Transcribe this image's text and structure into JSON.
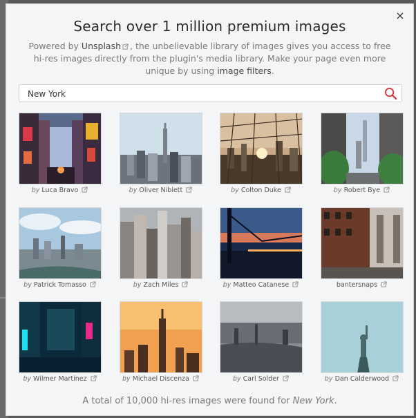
{
  "modal": {
    "title": "Search over 1 million premium images",
    "close_label": "×",
    "description": {
      "part1": "Powered by ",
      "brand": "Unsplash",
      "part2": ", the unbelievable library of images gives you access to free hi-res images directly from the plugin's media library. Make your page even more unique by using ",
      "filters_link": "image filters",
      "part3": "."
    }
  },
  "search": {
    "value": "New York",
    "placeholder": "",
    "button_icon": "search-icon"
  },
  "images": [
    {
      "by": "by",
      "author": "Luca Bravo"
    },
    {
      "by": "by",
      "author": "Oliver Niblett"
    },
    {
      "by": "by",
      "author": "Colton Duke"
    },
    {
      "by": "by",
      "author": "Robert Bye"
    },
    {
      "by": "by",
      "author": "Patrick Tomasso"
    },
    {
      "by": "by",
      "author": "Zach Miles"
    },
    {
      "by": "by",
      "author": "Matteo Catanese"
    },
    {
      "by": "",
      "author": "bantersnaps"
    },
    {
      "by": "by",
      "author": "Wilmer Martinez"
    },
    {
      "by": "by",
      "author": "Michael Discenza"
    },
    {
      "by": "by",
      "author": "Carl Solder"
    },
    {
      "by": "by",
      "author": "Dan Calderwood"
    }
  ],
  "footer": {
    "text": "A total of 10,000 hi-res images were found for ",
    "query": "New York",
    "end": "."
  },
  "colors": {
    "accent": "#d9363e",
    "modal_bg": "#f4f5f7"
  }
}
